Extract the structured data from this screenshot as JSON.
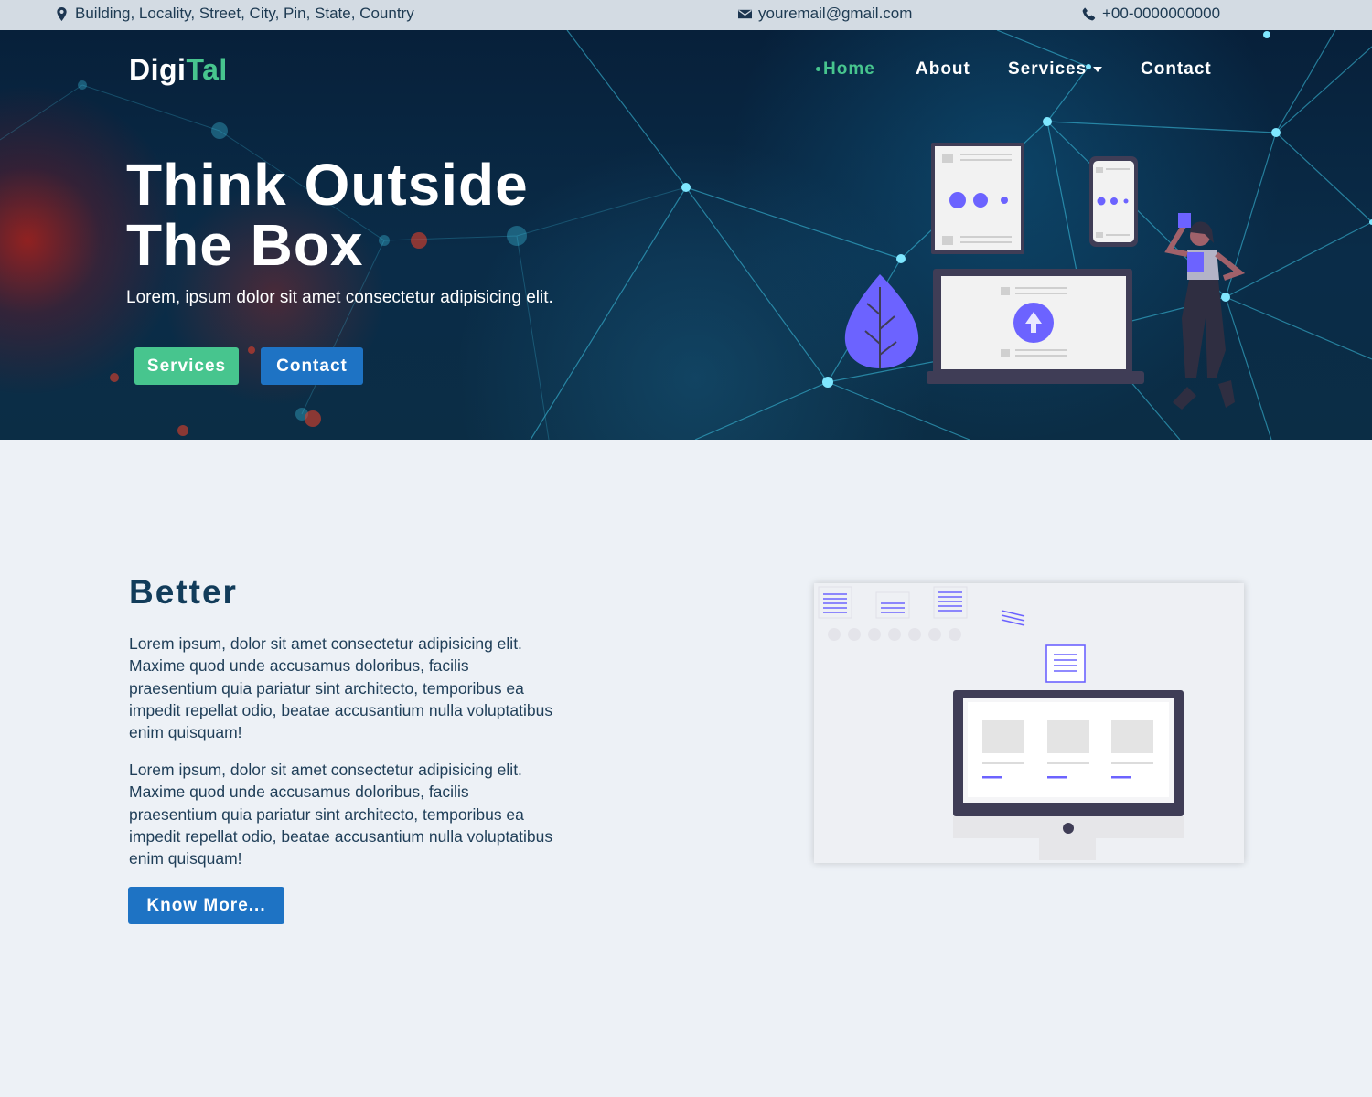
{
  "topbar": {
    "address": "Building, Locality, Street, City, Pin, State, Country",
    "email": "youremail@gmail.com",
    "phone": "+00-0000000000",
    "icons": [
      "map-pin-icon",
      "envelope-icon",
      "phone-icon"
    ]
  },
  "brand": {
    "logo_main": "Digi",
    "logo_accent": "Tal"
  },
  "nav": {
    "home": "Home",
    "about": "About",
    "services": "Services",
    "contact": "Contact",
    "active": "Home"
  },
  "hero": {
    "title_line1": "Think Outside",
    "title_line2": "The Box",
    "subtitle": "Lorem, ipsum dolor sit amet consectetur adipisicing elit.",
    "btn_services": "Services",
    "btn_contact": "Contact"
  },
  "about": {
    "title": "Better",
    "para1": "Lorem ipsum, dolor sit amet consectetur adipisicing elit. Maxime quod unde accusamus doloribus, facilis praesentium quia pariatur sint architecto, temporibus ea impedit repellat odio, beatae accusantium nulla voluptatibus enim quisquam!",
    "para2": "Lorem ipsum, dolor sit amet consectetur adipisicing elit. Maxime quod unde accusamus doloribus, facilis praesentium quia pariatur sint architecto, temporibus ea impedit repellat odio, beatae accusantium nulla voluptatibus enim quisquam!",
    "cta": "Know More..."
  },
  "colors": {
    "accent_green": "#47c58e",
    "accent_blue": "#1e73c4",
    "illustration_purple": "#6c63ff",
    "heading_navy": "#123c5a",
    "page_bg": "#edf1f6"
  }
}
